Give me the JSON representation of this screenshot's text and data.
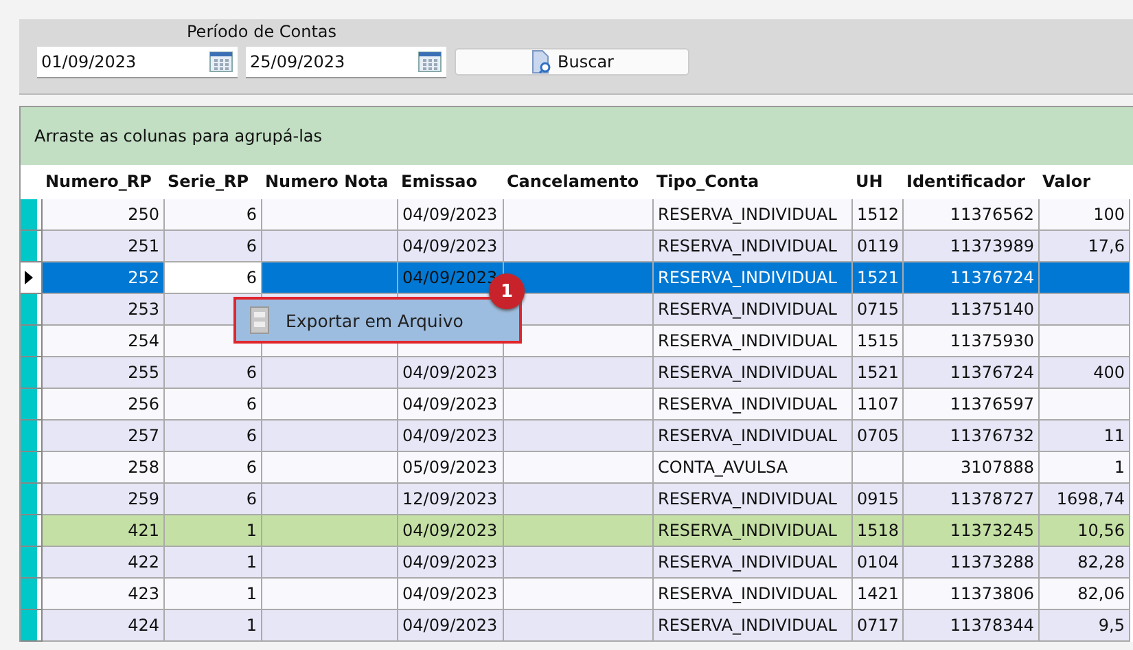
{
  "filter": {
    "label": "Período de Contas",
    "date_from": "01/09/2023",
    "date_to": "25/09/2023",
    "search_button": "Buscar"
  },
  "group_bar": {
    "text": "Arraste as colunas para agrupá-las"
  },
  "table": {
    "columns": [
      "Numero_RP",
      "Serie_RP",
      "Numero Nota",
      "Emissao",
      "Cancelamento",
      "Tipo_Conta",
      "UH",
      "Identificador",
      "Valor"
    ],
    "rows": [
      {
        "kind": "normal",
        "current": false,
        "cells": [
          "250",
          "6",
          null,
          "04/09/2023",
          null,
          "RESERVA_INDIVIDUAL",
          "1512",
          "11376562",
          "100"
        ]
      },
      {
        "kind": "normal",
        "current": false,
        "cells": [
          "251",
          "6",
          null,
          "04/09/2023",
          null,
          "RESERVA_INDIVIDUAL",
          "0119",
          "11373989",
          "17,6"
        ]
      },
      {
        "kind": "selected",
        "current": true,
        "cells": [
          "252",
          "6",
          null,
          "04/09/2023",
          null,
          "RESERVA_INDIVIDUAL",
          "1521",
          "11376724",
          null
        ]
      },
      {
        "kind": "normal",
        "current": false,
        "cells": [
          "253",
          null,
          null,
          null,
          null,
          "RESERVA_INDIVIDUAL",
          "0715",
          "11375140",
          null
        ]
      },
      {
        "kind": "normal",
        "current": false,
        "cells": [
          "254",
          null,
          null,
          null,
          null,
          "RESERVA_INDIVIDUAL",
          "1515",
          "11375930",
          null
        ]
      },
      {
        "kind": "normal",
        "current": false,
        "cells": [
          "255",
          "6",
          null,
          "04/09/2023",
          null,
          "RESERVA_INDIVIDUAL",
          "1521",
          "11376724",
          "400"
        ]
      },
      {
        "kind": "normal",
        "current": false,
        "cells": [
          "256",
          "6",
          null,
          "04/09/2023",
          null,
          "RESERVA_INDIVIDUAL",
          "1107",
          "11376597",
          null
        ]
      },
      {
        "kind": "normal",
        "current": false,
        "cells": [
          "257",
          "6",
          null,
          "04/09/2023",
          null,
          "RESERVA_INDIVIDUAL",
          "0705",
          "11376732",
          "11"
        ]
      },
      {
        "kind": "normal",
        "current": false,
        "cells": [
          "258",
          "6",
          null,
          "05/09/2023",
          null,
          "CONTA_AVULSA",
          null,
          "3107888",
          "1"
        ]
      },
      {
        "kind": "normal",
        "current": false,
        "cells": [
          "259",
          "6",
          null,
          "12/09/2023",
          null,
          "RESERVA_INDIVIDUAL",
          "0915",
          "11378727",
          "1698,74"
        ]
      },
      {
        "kind": "highlighted",
        "current": false,
        "cells": [
          "421",
          "1",
          null,
          "04/09/2023",
          null,
          "RESERVA_INDIVIDUAL",
          "1518",
          "11373245",
          "10,56"
        ]
      },
      {
        "kind": "normal",
        "current": false,
        "cells": [
          "422",
          "1",
          null,
          "04/09/2023",
          null,
          "RESERVA_INDIVIDUAL",
          "0104",
          "11373288",
          "82,28"
        ]
      },
      {
        "kind": "normal",
        "current": false,
        "cells": [
          "423",
          "1",
          null,
          "04/09/2023",
          null,
          "RESERVA_INDIVIDUAL",
          "1421",
          "11373806",
          "82,06"
        ]
      },
      {
        "kind": "normal",
        "current": false,
        "cells": [
          "424",
          "1",
          null,
          "04/09/2023",
          null,
          "RESERVA_INDIVIDUAL",
          "0717",
          "11378344",
          "9,5"
        ]
      }
    ]
  },
  "context_menu": {
    "items": [
      {
        "label": "Exportar em Arquivo",
        "selected": true
      }
    ]
  },
  "callout": {
    "number": "1"
  }
}
